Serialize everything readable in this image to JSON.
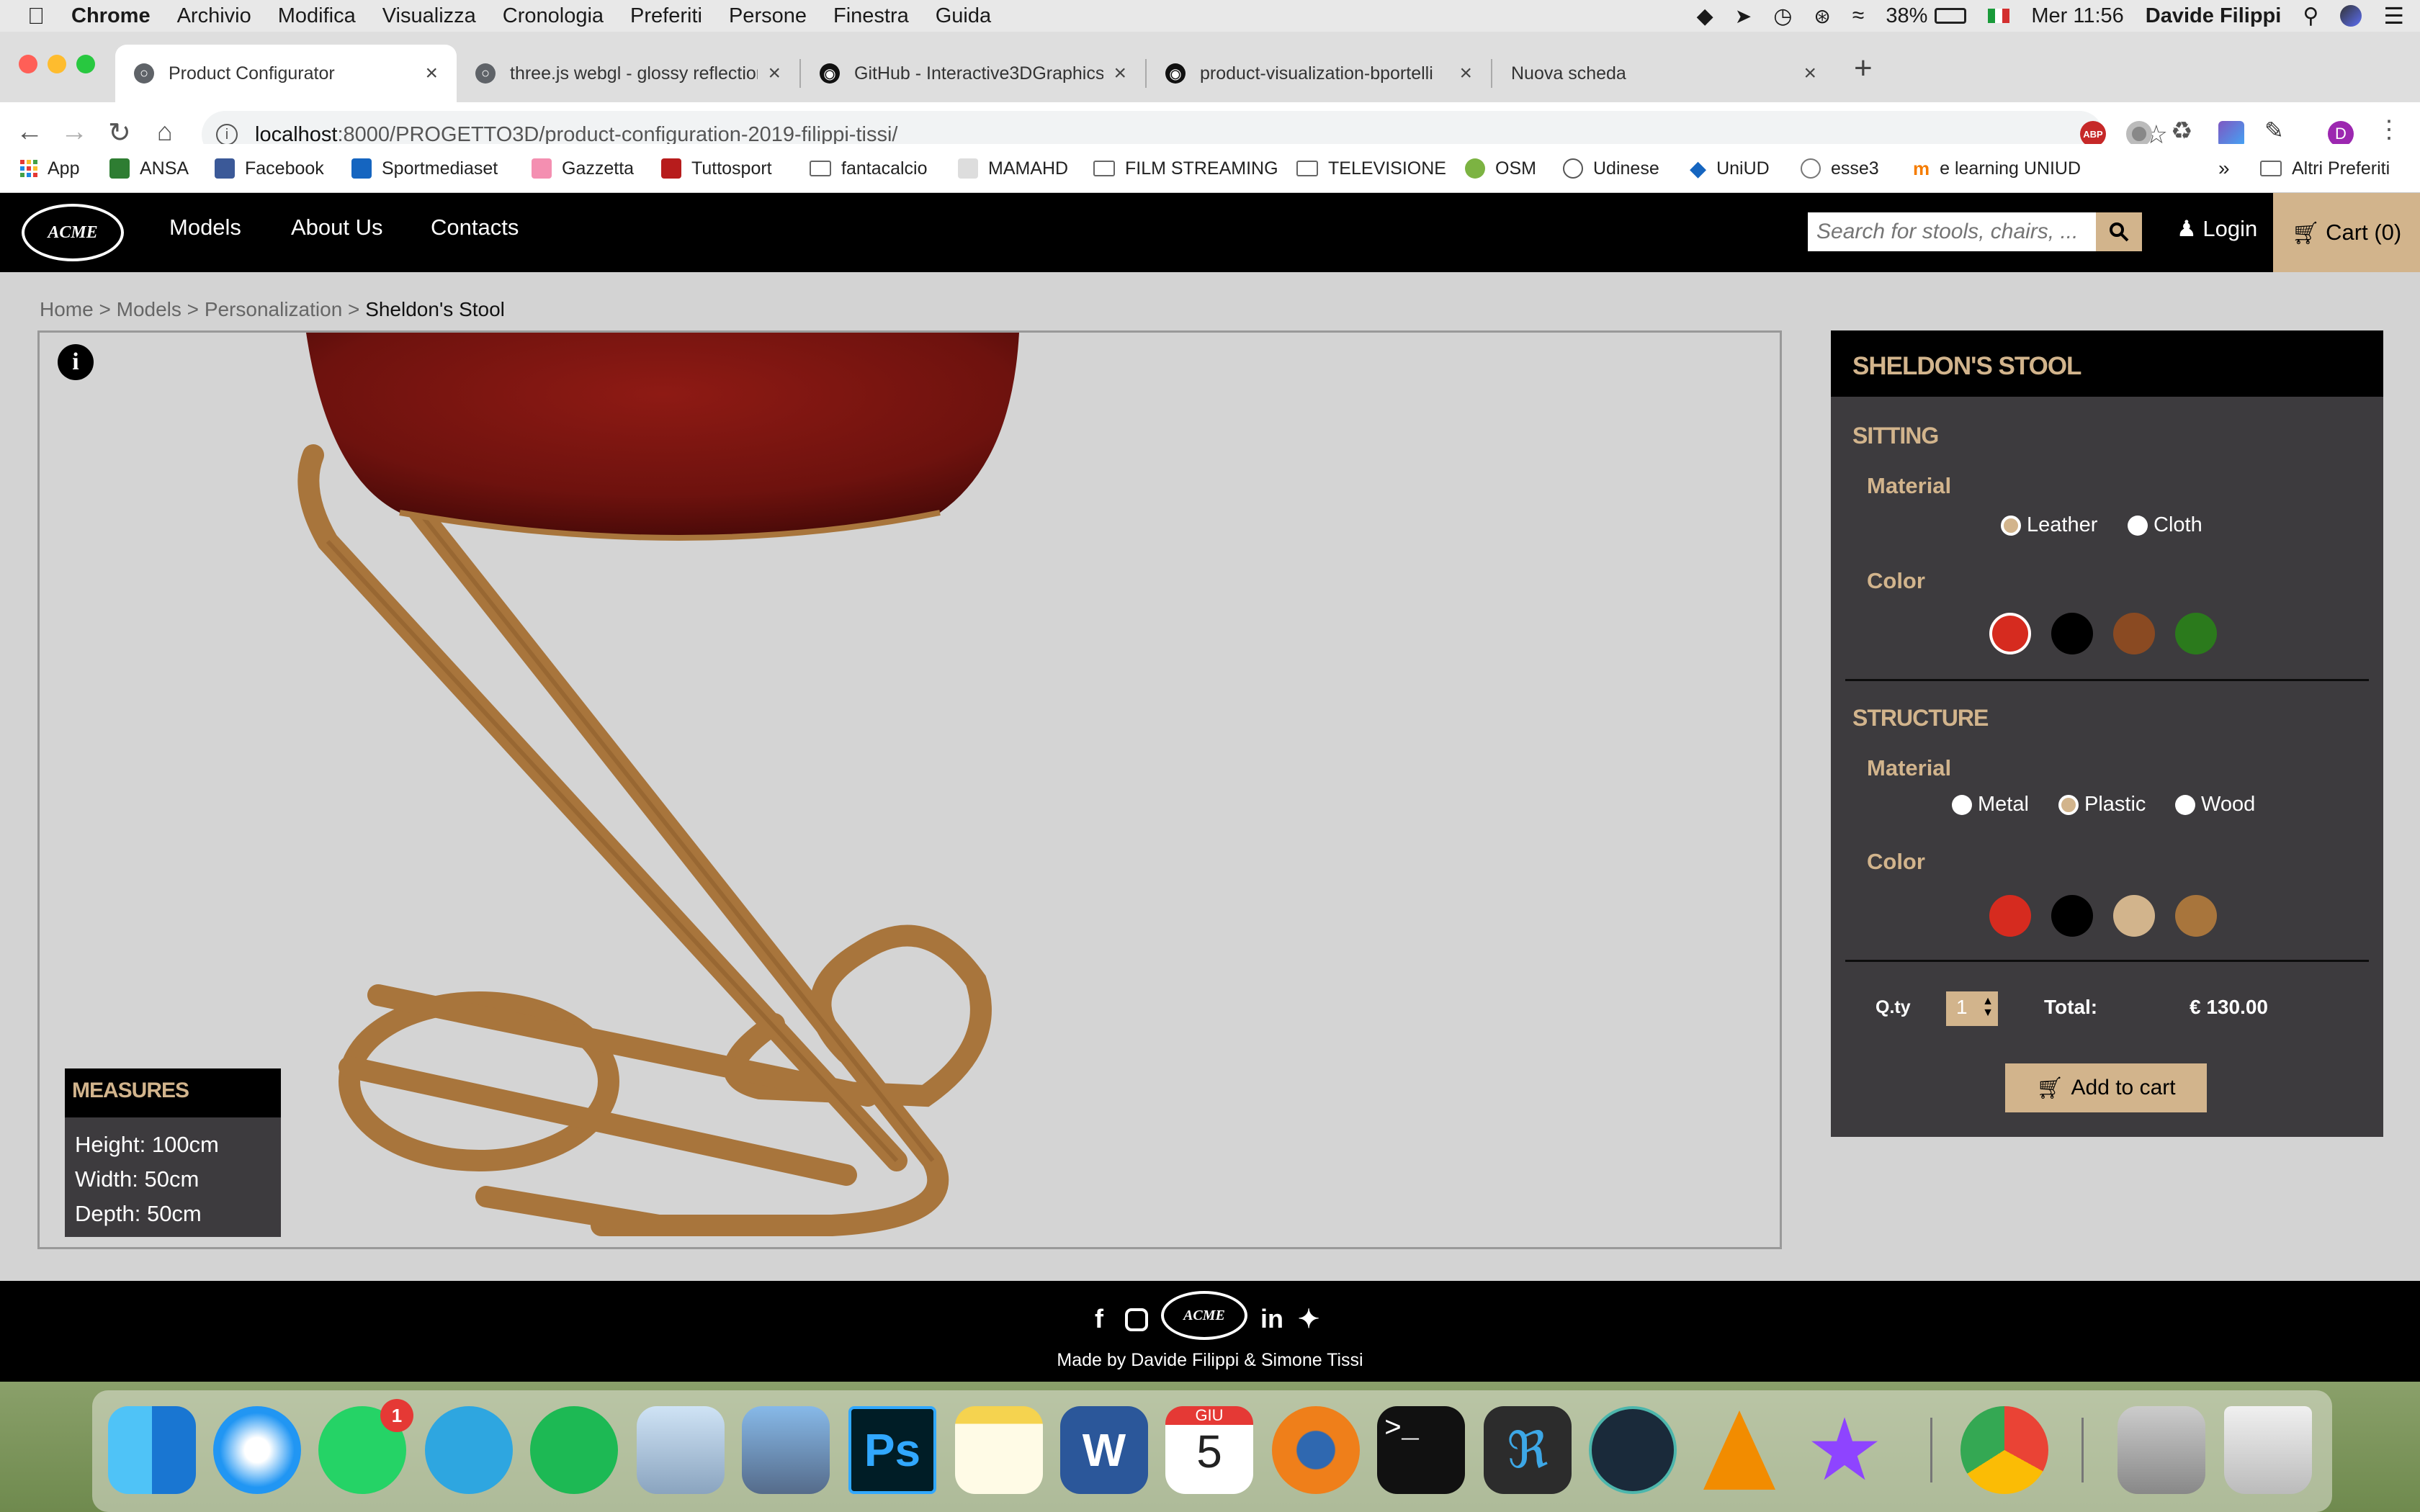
{
  "menubar": {
    "items": [
      "Chrome",
      "Archivio",
      "Modifica",
      "Visualizza",
      "Cronologia",
      "Preferiti",
      "Persone",
      "Finestra",
      "Guida"
    ],
    "battery": "38%",
    "clock": "Mer 11:56",
    "user": "Davide  Filippi"
  },
  "tabs": [
    {
      "title": "Product Configurator",
      "active": true
    },
    {
      "title": "three.js webgl - glossy reflections",
      "active": false
    },
    {
      "title": "GitHub - Interactive3DGraphics",
      "active": false
    },
    {
      "title": "product-visualization-bportelli",
      "active": false
    },
    {
      "title": "Nuova scheda",
      "active": false
    }
  ],
  "address": {
    "host": "localhost",
    "path": ":8000/PROGETTO3D/product-configuration-2019-filippi-tissi/"
  },
  "bookmarks": [
    "App",
    "ANSA",
    "Facebook",
    "Sportmediaset",
    "Gazzetta",
    "Tuttosport",
    "fantacalcio",
    "MAMAHD",
    "FILM STREAMING",
    "TELEVISIONE",
    "OSM",
    "Udinese",
    "UniUD",
    "esse3",
    "e learning UNIUD",
    "»",
    "Altri Preferiti"
  ],
  "site": {
    "logo": "ACME",
    "nav": [
      "Models",
      "About Us",
      "Contacts"
    ],
    "search_placeholder": "Search for stools, chairs, ...",
    "login": "Login",
    "cart": "Cart (0)"
  },
  "breadcrumb": {
    "home": "Home",
    "models": "Models",
    "personalization": "Personalization",
    "current": "Sheldon's Stool",
    "sep": ">"
  },
  "measures": {
    "title": "MEASURES",
    "height": "Height: 100cm",
    "width": "Width: 50cm",
    "depth": "Depth: 50cm"
  },
  "config": {
    "title": "SHELDON'S STOOL",
    "sitting": {
      "title": "SITTING",
      "material_label": "Material",
      "materials": [
        "Leather",
        "Cloth"
      ],
      "selected_material": "Leather",
      "color_label": "Color",
      "colors": [
        "#d62b1f",
        "#000000",
        "#8a4a22",
        "#2b7a1c"
      ],
      "selected_color": "#d62b1f"
    },
    "structure": {
      "title": "STRUCTURE",
      "material_label": "Material",
      "materials": [
        "Metal",
        "Plastic",
        "Wood"
      ],
      "selected_material": "Plastic",
      "color_label": "Color",
      "colors": [
        "#d62b1f",
        "#000000",
        "#d2b48c",
        "#a8753c"
      ]
    },
    "qty_label": "Q.ty",
    "qty": "1",
    "total_label": "Total:",
    "total": "€ 130.00",
    "add_to_cart": "Add to cart"
  },
  "footer": {
    "logo": "ACME",
    "made_by": "Made by Davide Filippi & Simone Tissi"
  },
  "dock": {
    "whatsapp_badge": "1",
    "calendar_month": "GIU",
    "calendar_day": "5"
  },
  "colors": {
    "accent": "#d2b48c",
    "panel": "#3d3b3e",
    "header": "#000000"
  }
}
